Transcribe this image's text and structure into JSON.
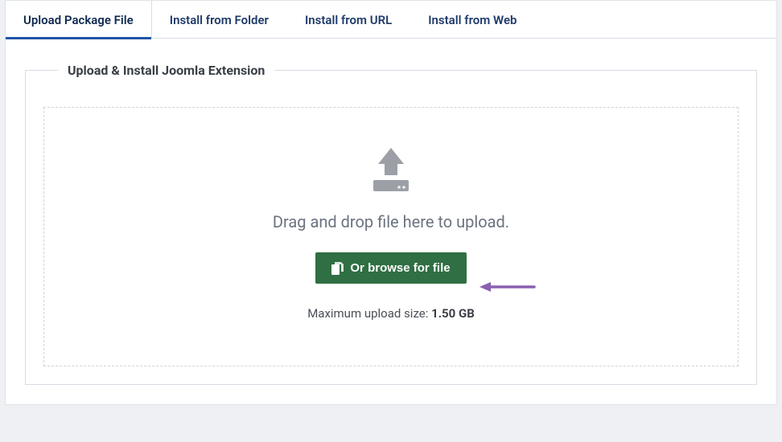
{
  "tabs": [
    {
      "label": "Upload Package File",
      "active": true
    },
    {
      "label": "Install from Folder",
      "active": false
    },
    {
      "label": "Install from URL",
      "active": false
    },
    {
      "label": "Install from Web",
      "active": false
    }
  ],
  "fieldset": {
    "legend": "Upload & Install Joomla Extension"
  },
  "dropzone": {
    "drag_text": "Drag and drop file here to upload.",
    "browse_label": "Or browse for file",
    "max_size_prefix": "Maximum upload size: ",
    "max_size_value": "1.50 GB"
  }
}
